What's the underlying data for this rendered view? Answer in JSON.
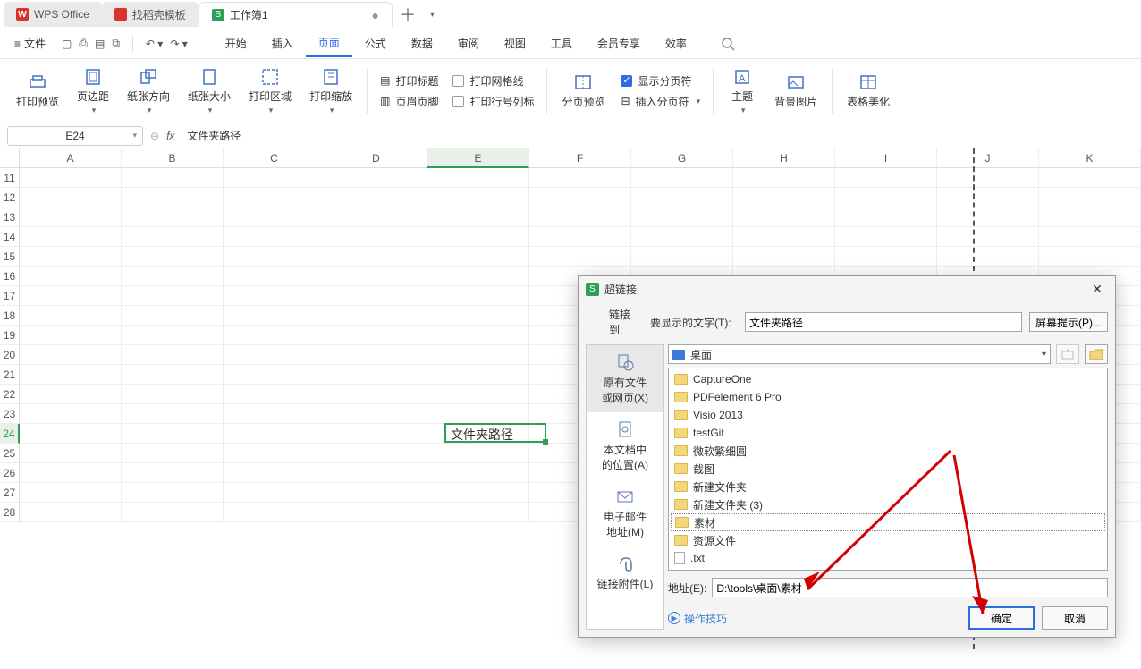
{
  "tabs": {
    "wps": "WPS Office",
    "templates": "找稻壳模板",
    "doc": "工作簿1",
    "add": "＋",
    "more": "▾"
  },
  "menu": {
    "file": "文件",
    "items": [
      "开始",
      "插入",
      "页面",
      "公式",
      "数据",
      "审阅",
      "视图",
      "工具",
      "会员专享",
      "效率"
    ],
    "active_index": 2
  },
  "ribbon": {
    "print_preview": "打印预览",
    "page_margin": "页边距",
    "paper_dir": "纸张方向",
    "paper_size": "纸张大小",
    "print_area": "打印区域",
    "print_scale": "打印缩放",
    "col_icon1": "打印标题",
    "col_icon2": "页眉页脚",
    "chk_grid": "打印网格线",
    "chk_rownum": "打印行号列标",
    "page_break_preview": "分页预览",
    "show_page_breaks": "显示分页符",
    "insert_page_break": "插入分页符",
    "theme": "主题",
    "bg_image": "背景图片",
    "table_beautify": "表格美化"
  },
  "fbar": {
    "name": "E24",
    "fx": "文件夹路径"
  },
  "sheet": {
    "cols": [
      "A",
      "B",
      "C",
      "D",
      "E",
      "F",
      "G",
      "H",
      "I",
      "J",
      "K"
    ],
    "rows": [
      "11",
      "12",
      "13",
      "14",
      "15",
      "16",
      "17",
      "18",
      "19",
      "20",
      "21",
      "22",
      "23",
      "24",
      "25",
      "26",
      "27",
      "28"
    ],
    "active_row_index": 13,
    "active_col_index": 4,
    "cell_value": "文件夹路径"
  },
  "dialog": {
    "title": "超链接",
    "link_to": "链接到:",
    "display_label": "要显示的文字(T):",
    "display_value": "文件夹路径",
    "tooltip_btn": "屏幕提示(P)...",
    "side": [
      {
        "label": "原有文件\n或网页(X)"
      },
      {
        "label": "本文档中\n的位置(A)"
      },
      {
        "label": "电子邮件\n地址(M)"
      },
      {
        "label": "链接附件(L)"
      }
    ],
    "path_combo": "桌面",
    "files": [
      {
        "name": "CaptureOne",
        "type": "folder"
      },
      {
        "name": "PDFelement 6 Pro",
        "type": "folder"
      },
      {
        "name": "Visio 2013",
        "type": "folder"
      },
      {
        "name": "testGit",
        "type": "folder"
      },
      {
        "name": "微软繁细圆",
        "type": "folder"
      },
      {
        "name": "截图",
        "type": "folder"
      },
      {
        "name": "新建文件夹",
        "type": "folder"
      },
      {
        "name": "新建文件夹 (3)",
        "type": "folder"
      },
      {
        "name": "素材",
        "type": "folder",
        "selected": true
      },
      {
        "name": "资源文件",
        "type": "folder"
      },
      {
        "name": ".txt",
        "type": "txt"
      }
    ],
    "addr_label": "地址(E):",
    "addr_value": "D:\\tools\\桌面\\素材",
    "tips": "操作技巧",
    "ok": "确定",
    "cancel": "取消"
  }
}
